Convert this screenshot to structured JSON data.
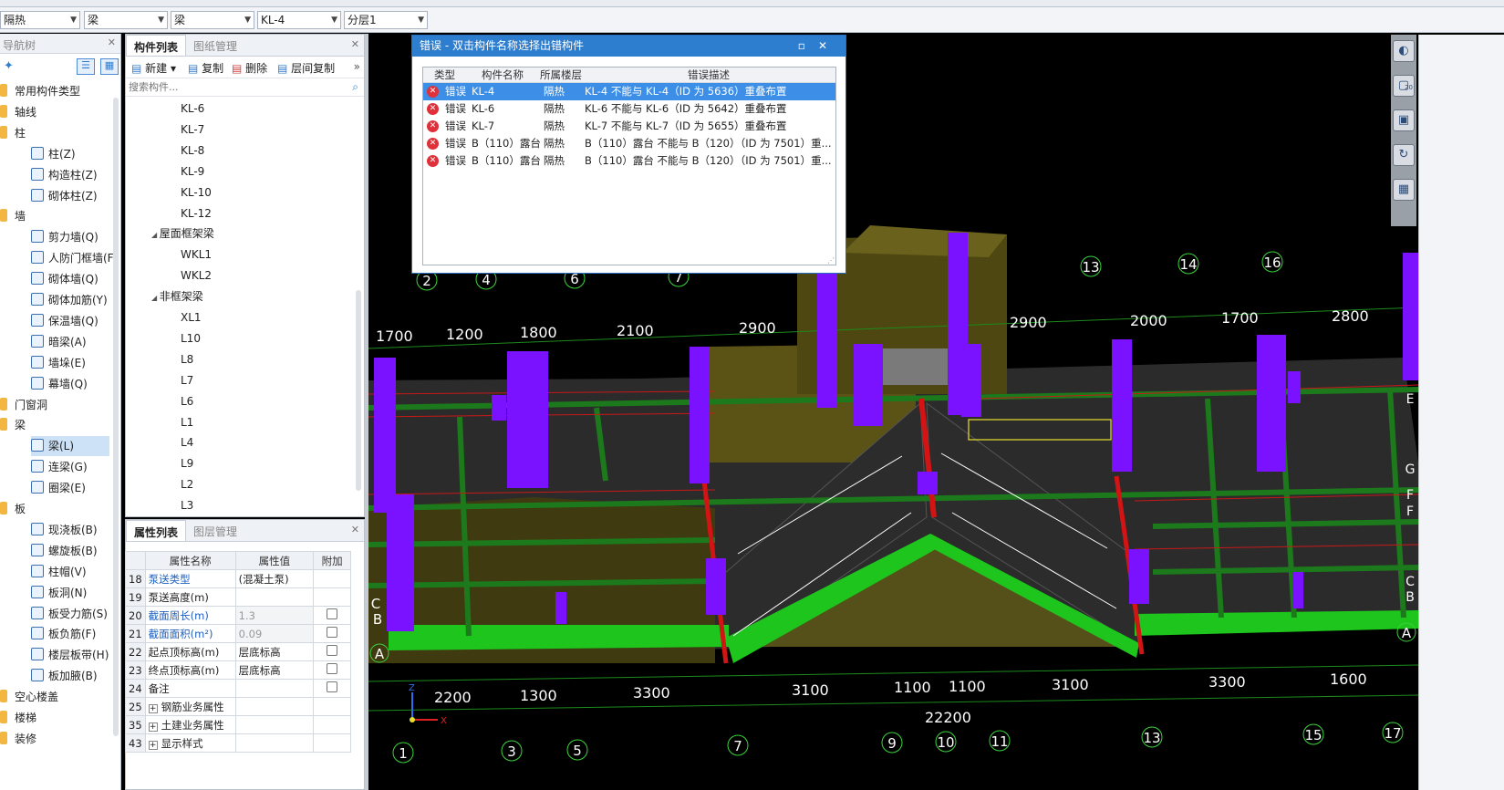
{
  "toolbar": {
    "combos": [
      "隔热",
      "梁",
      "梁",
      "KL-4",
      "分层1"
    ]
  },
  "nav": {
    "title": "导航树",
    "items": [
      {
        "label": "常用构件类型",
        "level": 0,
        "kind": "folder"
      },
      {
        "label": "轴线",
        "level": 0,
        "kind": "folder"
      },
      {
        "label": "柱",
        "level": 0,
        "kind": "folder"
      },
      {
        "label": "柱(Z)",
        "level": 1,
        "kind": "item"
      },
      {
        "label": "构造柱(Z)",
        "level": 1,
        "kind": "item"
      },
      {
        "label": "砌体柱(Z)",
        "level": 1,
        "kind": "item"
      },
      {
        "label": "墙",
        "level": 0,
        "kind": "folder"
      },
      {
        "label": "剪力墙(Q)",
        "level": 1,
        "kind": "item"
      },
      {
        "label": "人防门框墙(F",
        "level": 1,
        "kind": "item"
      },
      {
        "label": "砌体墙(Q)",
        "level": 1,
        "kind": "item"
      },
      {
        "label": "砌体加筋(Y)",
        "level": 1,
        "kind": "item"
      },
      {
        "label": "保温墙(Q)",
        "level": 1,
        "kind": "item"
      },
      {
        "label": "暗梁(A)",
        "level": 1,
        "kind": "item"
      },
      {
        "label": "墙垛(E)",
        "level": 1,
        "kind": "item"
      },
      {
        "label": "幕墙(Q)",
        "level": 1,
        "kind": "item"
      },
      {
        "label": "门窗洞",
        "level": 0,
        "kind": "folder"
      },
      {
        "label": "梁",
        "level": 0,
        "kind": "folder"
      },
      {
        "label": "梁(L)",
        "level": 1,
        "kind": "item",
        "selected": true
      },
      {
        "label": "连梁(G)",
        "level": 1,
        "kind": "item"
      },
      {
        "label": "圈梁(E)",
        "level": 1,
        "kind": "item"
      },
      {
        "label": "板",
        "level": 0,
        "kind": "folder"
      },
      {
        "label": "现浇板(B)",
        "level": 1,
        "kind": "item"
      },
      {
        "label": "螺旋板(B)",
        "level": 1,
        "kind": "item"
      },
      {
        "label": "柱帽(V)",
        "level": 1,
        "kind": "item"
      },
      {
        "label": "板洞(N)",
        "level": 1,
        "kind": "item"
      },
      {
        "label": "板受力筋(S)",
        "level": 1,
        "kind": "item"
      },
      {
        "label": "板负筋(F)",
        "level": 1,
        "kind": "item"
      },
      {
        "label": "楼层板带(H)",
        "level": 1,
        "kind": "item"
      },
      {
        "label": "板加腋(B)",
        "level": 1,
        "kind": "item"
      },
      {
        "label": "空心楼盖",
        "level": 0,
        "kind": "folder"
      },
      {
        "label": "楼梯",
        "level": 0,
        "kind": "folder"
      },
      {
        "label": "装修",
        "level": 0,
        "kind": "folder"
      }
    ]
  },
  "components": {
    "tabs": [
      "构件列表",
      "图纸管理"
    ],
    "actions": [
      "新建",
      "复制",
      "删除",
      "层间复制"
    ],
    "search_placeholder": "搜索构件...",
    "items": [
      {
        "label": "KL-6",
        "level": 2
      },
      {
        "label": "KL-7",
        "level": 2
      },
      {
        "label": "KL-8",
        "level": 2
      },
      {
        "label": "KL-9",
        "level": 2
      },
      {
        "label": "KL-10",
        "level": 2
      },
      {
        "label": "KL-12",
        "level": 2
      },
      {
        "label": "屋面框架梁",
        "level": 1
      },
      {
        "label": "WKL1",
        "level": 2
      },
      {
        "label": "WKL2",
        "level": 2
      },
      {
        "label": "非框架梁",
        "level": 1
      },
      {
        "label": "XL1",
        "level": 2
      },
      {
        "label": "L10",
        "level": 2
      },
      {
        "label": "L8",
        "level": 2
      },
      {
        "label": "L7",
        "level": 2
      },
      {
        "label": "L6",
        "level": 2
      },
      {
        "label": "L1",
        "level": 2
      },
      {
        "label": "L4",
        "level": 2
      },
      {
        "label": "L9",
        "level": 2
      },
      {
        "label": "L2",
        "level": 2
      },
      {
        "label": "L3",
        "level": 2
      }
    ]
  },
  "properties": {
    "tabs": [
      "属性列表",
      "图层管理"
    ],
    "headers": [
      "属性名称",
      "属性值",
      "附加"
    ],
    "rows": [
      {
        "num": "18",
        "name": "泵送类型",
        "value": "(混凝土泵)",
        "blue": true,
        "check": false,
        "gray": false
      },
      {
        "num": "19",
        "name": "泵送高度(m)",
        "value": "",
        "blue": false,
        "check": false,
        "gray": false
      },
      {
        "num": "20",
        "name": "截面周长(m)",
        "value": "1.3",
        "blue": true,
        "check": true,
        "gray": true
      },
      {
        "num": "21",
        "name": "截面面积(m²)",
        "value": "0.09",
        "blue": true,
        "check": true,
        "gray": true
      },
      {
        "num": "22",
        "name": "起点顶标高(m)",
        "value": "层底标高",
        "blue": false,
        "check": true,
        "gray": false
      },
      {
        "num": "23",
        "name": "终点顶标高(m)",
        "value": "层底标高",
        "blue": false,
        "check": true,
        "gray": false
      },
      {
        "num": "24",
        "name": "备注",
        "value": "",
        "blue": false,
        "check": true,
        "gray": false
      },
      {
        "num": "25",
        "name": "钢筋业务属性",
        "value": "",
        "blue": false,
        "check": false,
        "gray": false,
        "expand": true
      },
      {
        "num": "35",
        "name": "土建业务属性",
        "value": "",
        "blue": false,
        "check": false,
        "gray": false,
        "expand": true
      },
      {
        "num": "43",
        "name": "显示样式",
        "value": "",
        "blue": false,
        "check": false,
        "gray": false,
        "expand": true
      }
    ]
  },
  "dialog": {
    "title": "错误 - 双击构件名称选择出错构件",
    "headers": [
      "类型",
      "构件名称",
      "所属楼层",
      "错误描述"
    ],
    "rows": [
      {
        "type": "错误",
        "name": "KL-4",
        "floor": "隔热",
        "desc": "KL-4 不能与 KL-4（ID 为 5636）重叠布置"
      },
      {
        "type": "错误",
        "name": "KL-6",
        "floor": "隔热",
        "desc": "KL-6 不能与 KL-6（ID 为 5642）重叠布置"
      },
      {
        "type": "错误",
        "name": "KL-7",
        "floor": "隔热",
        "desc": "KL-7 不能与 KL-7（ID 为 5655）重叠布置"
      },
      {
        "type": "错误",
        "name": "B（110）露台",
        "floor": "隔热",
        "desc": "B（110）露台 不能与 B（120）（ID 为 7501）重..."
      },
      {
        "type": "错误",
        "name": "B（110）露台",
        "floor": "隔热",
        "desc": "B（110）露台 不能与 B（120）（ID 为 7501）重..."
      }
    ]
  },
  "viewport": {
    "top_dims": [
      "1700",
      "1200",
      "1800",
      "2100",
      "2900",
      "2900",
      "2000",
      "1700",
      "2800"
    ],
    "bottom_dims": [
      "2200",
      "1300",
      "3300",
      "3100",
      "1100",
      "1100",
      "3100",
      "3300",
      "1600"
    ],
    "total_dim": "22200",
    "axis_top": [
      "2",
      "4",
      "6",
      "7",
      "13",
      "14",
      "16"
    ],
    "axis_bottom": [
      "1",
      "3",
      "5",
      "7",
      "9",
      "10",
      "11",
      "13",
      "15",
      "17"
    ],
    "axis_letters": [
      "A",
      "B",
      "C",
      "A"
    ],
    "right_letters": [
      "E",
      "G",
      "F",
      "F",
      "C",
      "B"
    ],
    "tool_badge": "20",
    "colors": {
      "column": "#7a12ff",
      "green_beam": "#1dc51d",
      "red_line": "#d21414",
      "olive_wall": "#5b5316",
      "slab": "#2a2a2a"
    }
  }
}
